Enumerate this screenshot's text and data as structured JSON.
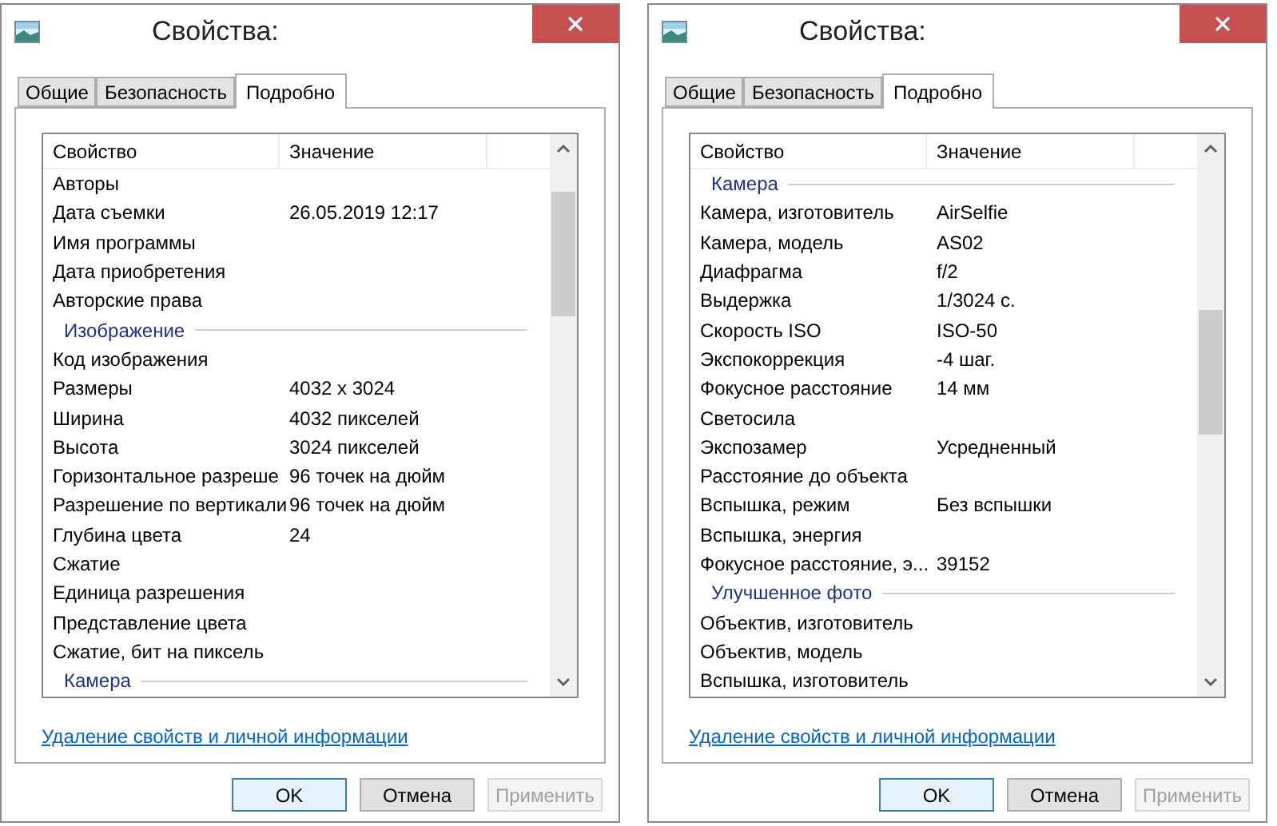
{
  "dialogs": [
    {
      "title": "Свойства:",
      "tabs": [
        {
          "label": "Общие",
          "selected": false
        },
        {
          "label": "Безопасность",
          "selected": false
        },
        {
          "label": "Подробно",
          "selected": true
        }
      ],
      "columns": [
        "Свойство",
        "Значение"
      ],
      "rows": [
        {
          "kind": "row",
          "name": "Авторы"
        },
        {
          "kind": "row",
          "name": "Дата съемки",
          "value": "26.05.2019 12:17"
        },
        {
          "kind": "row",
          "name": "Имя программы"
        },
        {
          "kind": "row",
          "name": "Дата приобретения"
        },
        {
          "kind": "row",
          "name": "Авторские права"
        },
        {
          "kind": "group",
          "name": "Изображение"
        },
        {
          "kind": "row",
          "name": "Код изображения"
        },
        {
          "kind": "row",
          "name": "Размеры",
          "value": "4032 x 3024"
        },
        {
          "kind": "row",
          "name": "Ширина",
          "value": "4032 пикселей"
        },
        {
          "kind": "row",
          "name": "Высота",
          "value": "3024 пикселей"
        },
        {
          "kind": "row",
          "name": "Горизонтальное разреше",
          "value": "96 точек на дюйм"
        },
        {
          "kind": "row",
          "name": "Разрешение по вертикали",
          "value": "96 точек на дюйм"
        },
        {
          "kind": "row",
          "name": "Глубина цвета",
          "value": "24"
        },
        {
          "kind": "row",
          "name": "Сжатие"
        },
        {
          "kind": "row",
          "name": "Единица разрешения"
        },
        {
          "kind": "row",
          "name": "Представление цвета"
        },
        {
          "kind": "row",
          "name": "Сжатие, бит на пиксель"
        },
        {
          "kind": "group",
          "name": "Камера"
        }
      ],
      "link": "Удаление свойств и личной информации",
      "buttons": [
        {
          "label": "OK",
          "default": true,
          "disabled": false
        },
        {
          "label": "Отмена",
          "default": false,
          "disabled": false
        },
        {
          "label": "Применить",
          "default": false,
          "disabled": true
        }
      ]
    },
    {
      "title": "Свойства:",
      "tabs": [
        {
          "label": "Общие",
          "selected": false
        },
        {
          "label": "Безопасность",
          "selected": false
        },
        {
          "label": "Подробно",
          "selected": true
        }
      ],
      "columns": [
        "Свойство",
        "Значение"
      ],
      "rows": [
        {
          "kind": "group",
          "name": "Камера"
        },
        {
          "kind": "row",
          "name": "Камера, изготовитель",
          "value": "AirSelfie"
        },
        {
          "kind": "row",
          "name": "Камера, модель",
          "value": "AS02"
        },
        {
          "kind": "row",
          "name": "Диафрагма",
          "value": "f/2"
        },
        {
          "kind": "row",
          "name": "Выдержка",
          "value": "1/3024 с."
        },
        {
          "kind": "row",
          "name": "Скорость ISO",
          "value": "ISO-50"
        },
        {
          "kind": "row",
          "name": "Экспокоррекция",
          "value": "-4 шаг."
        },
        {
          "kind": "row",
          "name": "Фокусное расстояние",
          "value": "14 мм"
        },
        {
          "kind": "row",
          "name": "Светосила"
        },
        {
          "kind": "row",
          "name": "Экспозамер",
          "value": "Усредненный"
        },
        {
          "kind": "row",
          "name": "Расстояние до объекта"
        },
        {
          "kind": "row",
          "name": "Вспышка, режим",
          "value": "Без вспышки"
        },
        {
          "kind": "row",
          "name": "Вспышка, энергия"
        },
        {
          "kind": "row",
          "name": "Фокусное расстояние, э...",
          "value": "39152"
        },
        {
          "kind": "group",
          "name": "Улучшенное фото"
        },
        {
          "kind": "row",
          "name": "Объектив, изготовитель"
        },
        {
          "kind": "row",
          "name": "Объектив, модель"
        },
        {
          "kind": "row",
          "name": "Вспышка, изготовитель"
        }
      ],
      "link": "Удаление свойств и личной информации",
      "buttons": [
        {
          "label": "OK",
          "default": true,
          "disabled": false
        },
        {
          "label": "Отмена",
          "default": false,
          "disabled": false
        },
        {
          "label": "Применить",
          "default": false,
          "disabled": true
        }
      ]
    }
  ]
}
